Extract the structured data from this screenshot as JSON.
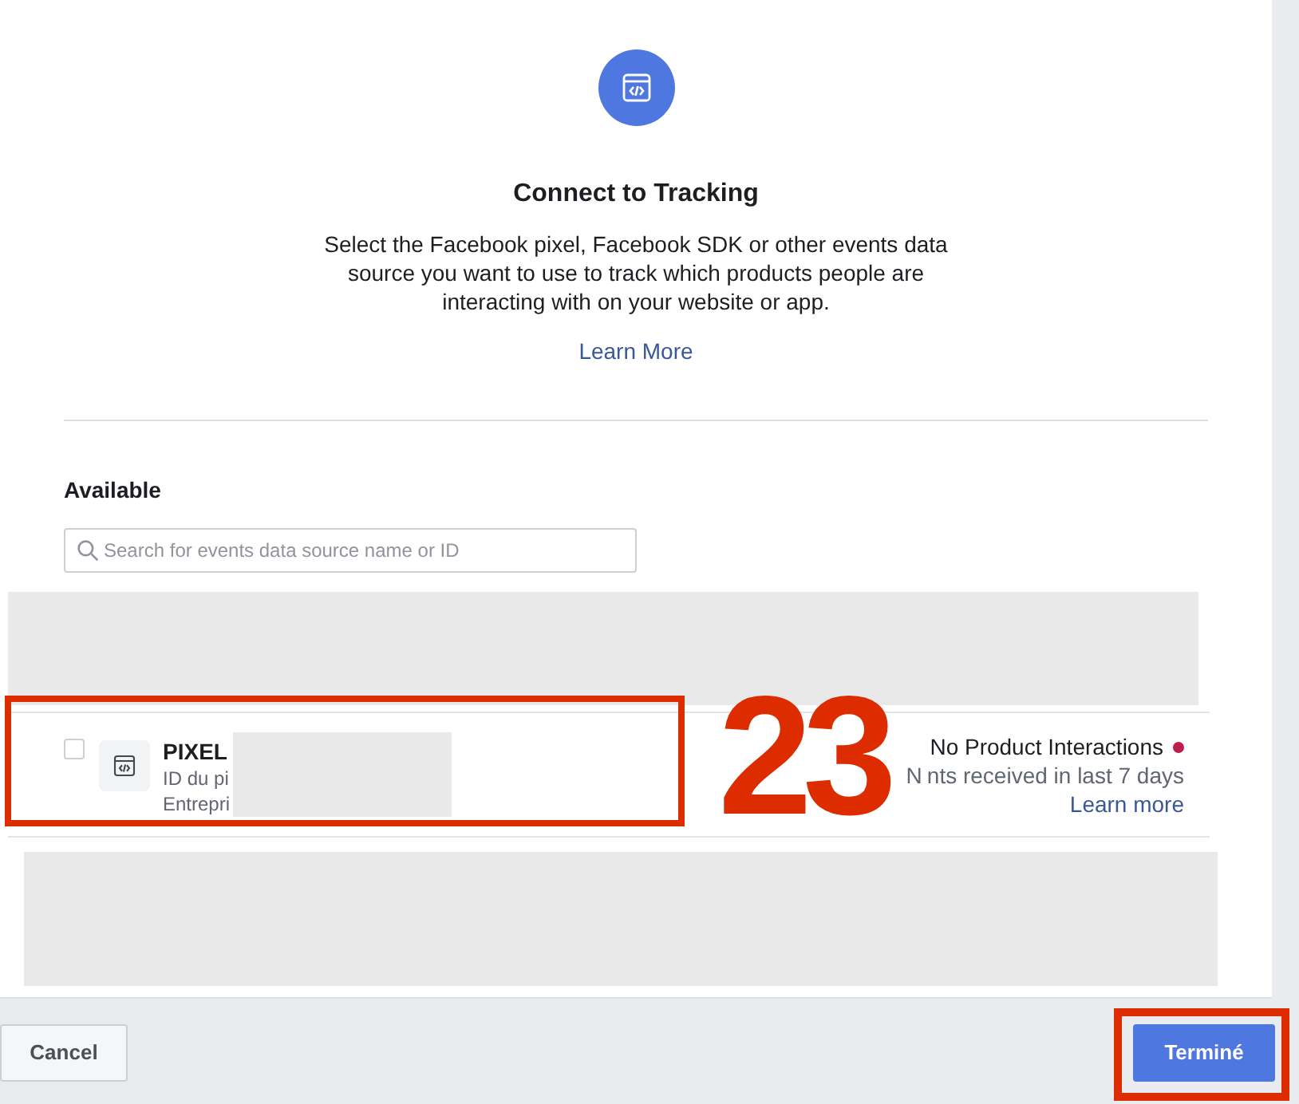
{
  "dialog": {
    "title": "Connect to Tracking",
    "description": "Select the Facebook pixel, Facebook SDK or other events data source you want to use to track which products people are interacting with on your website or app.",
    "learn_more": "Learn More"
  },
  "available": {
    "heading": "Available",
    "search": {
      "placeholder": "Search for events data source name or ID"
    },
    "items": [
      {
        "name": "PIXEL",
        "id_line": "ID du pi",
        "business_line": "Entrepri",
        "status": "No Product Interactions",
        "color": "#be1e4b",
        "detail_start": "N",
        "detail_end": "nts received in last 7 days",
        "link": "Learn more",
        "checked": false
      }
    ]
  },
  "annotation": {
    "number": "23"
  },
  "footer": {
    "cancel": "Cancel",
    "done": "Terminé"
  }
}
